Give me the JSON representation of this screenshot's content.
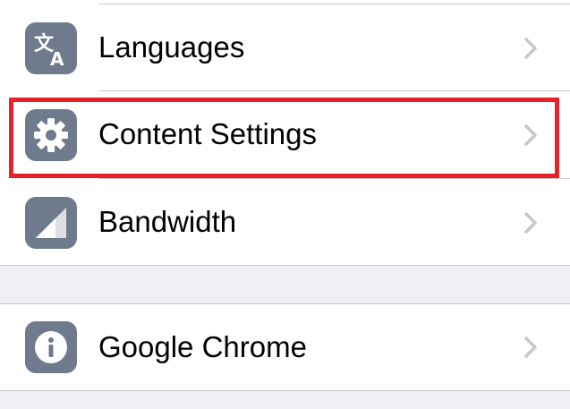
{
  "settings": {
    "top_group": [
      {
        "label": "Languages",
        "icon": "translate-icon"
      },
      {
        "label": "Content Settings",
        "icon": "gear-icon"
      },
      {
        "label": "Bandwidth",
        "icon": "signal-icon"
      }
    ],
    "bottom_group": [
      {
        "label": "Google Chrome",
        "icon": "info-icon"
      }
    ]
  },
  "colors": {
    "icon_background": "#6f7a8c",
    "highlight_border": "#e8202a",
    "chevron": "#c7c7cc",
    "group_background": "#efeff4"
  }
}
